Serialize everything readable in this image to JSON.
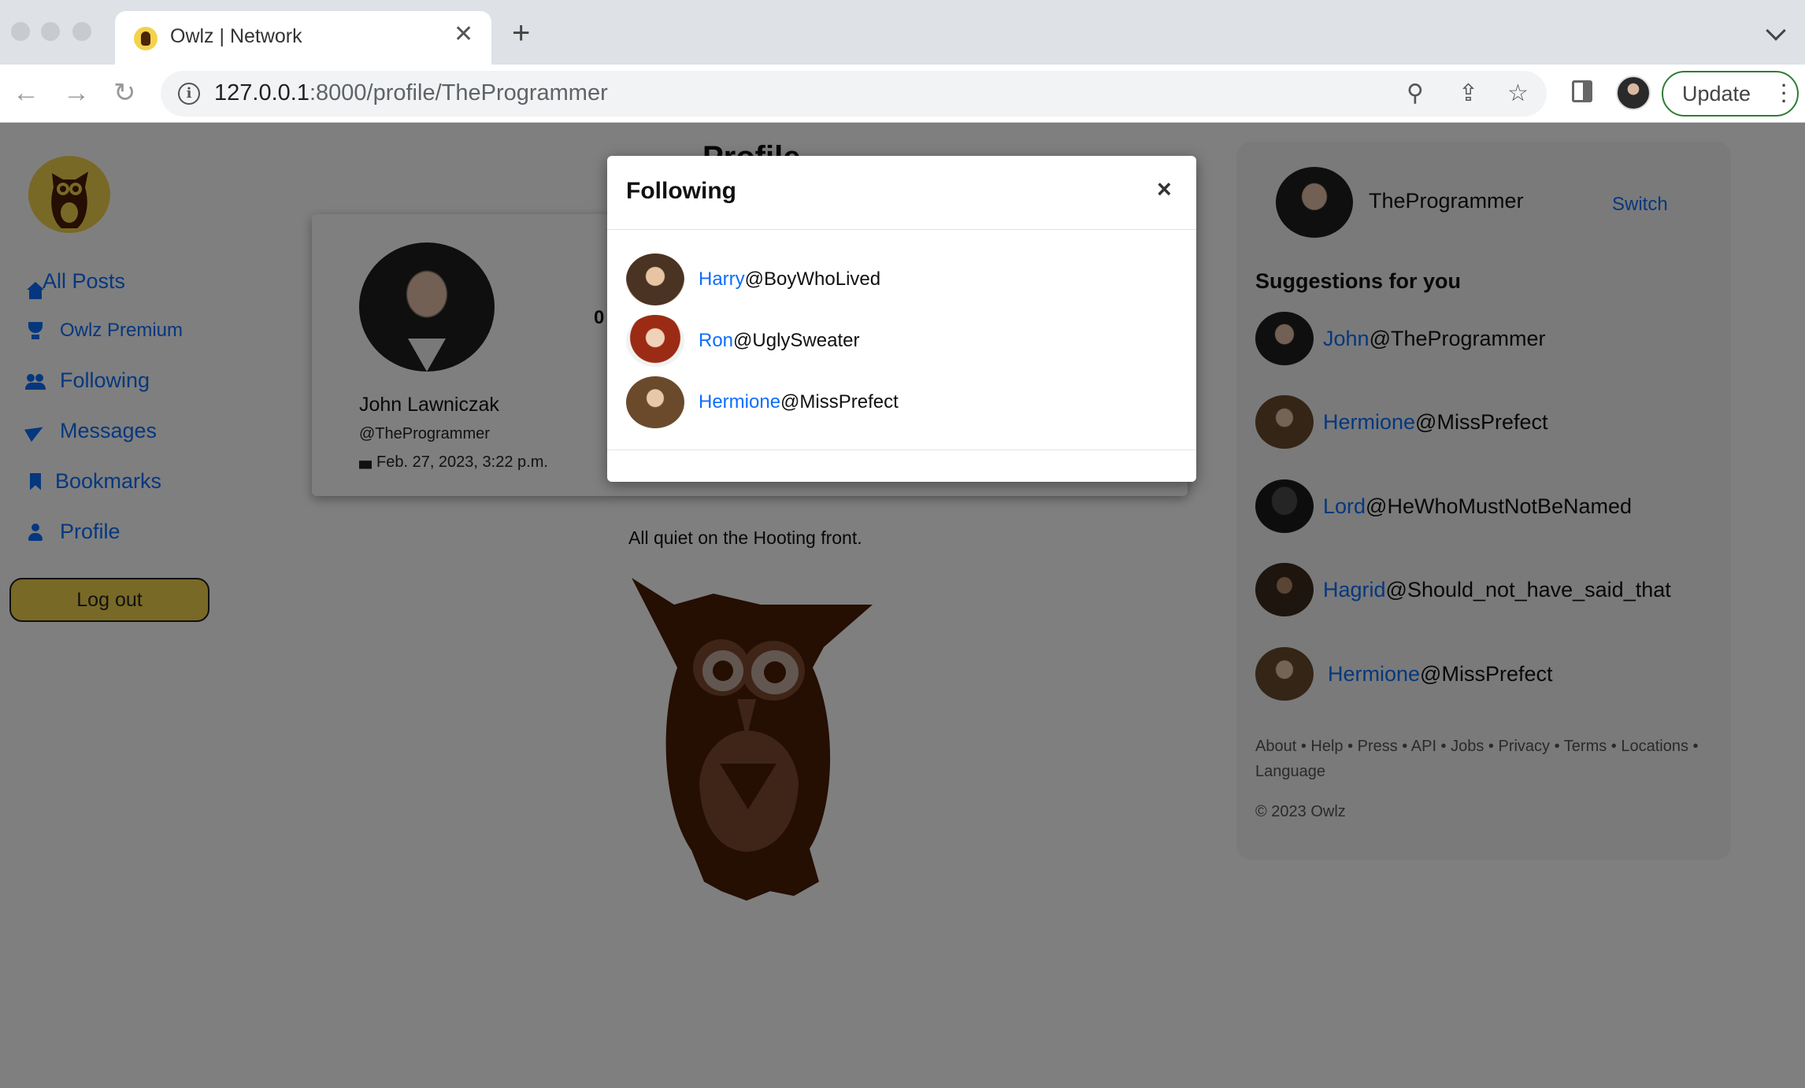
{
  "browser": {
    "tab_title": "Owlz | Network",
    "url_host": "127.0.0.1",
    "url_rest": ":8000/profile/TheProgrammer",
    "update_label": "Update"
  },
  "sidebar": {
    "items": [
      {
        "label": "All Posts",
        "icon": "home-icon"
      },
      {
        "label": "Owlz Premium",
        "icon": "trophy-icon"
      },
      {
        "label": "Following",
        "icon": "people-icon"
      },
      {
        "label": "Messages",
        "icon": "send-icon"
      },
      {
        "label": "Bookmarks",
        "icon": "bookmark-icon"
      },
      {
        "label": "Profile",
        "icon": "person-icon"
      }
    ],
    "logout_label": "Log out"
  },
  "main": {
    "page_title": "Profile",
    "profile": {
      "name": "John Lawniczak",
      "handle": "@TheProgrammer",
      "joined": "Feb. 27, 2023, 3:22 p.m.",
      "stat_visible": "0"
    },
    "empty_message": "All quiet on the Hooting front."
  },
  "right_panel": {
    "username": "TheProgrammer",
    "switch_label": "Switch",
    "heading": "Suggestions for you",
    "suggestions": [
      {
        "name": "John",
        "handle": "@TheProgrammer"
      },
      {
        "name": "Hermione",
        "handle": "@MissPrefect"
      },
      {
        "name": "Lord",
        "handle": "@HeWhoMustNotBeNamed"
      },
      {
        "name": "Hagrid",
        "handle": "@Should_not_have_said_that"
      },
      {
        "name": "Hermione",
        "handle": "@MissPrefect"
      }
    ],
    "footer_links": "About • Help • Press • API • Jobs • Privacy • Terms • Locations • Language",
    "copyright": "© 2023 Owlz"
  },
  "modal": {
    "title": "Following",
    "close_label": "×",
    "items": [
      {
        "name": "Harry",
        "handle": "@BoyWhoLived"
      },
      {
        "name": "Ron",
        "handle": "@UglySweater"
      },
      {
        "name": "Hermione",
        "handle": "@MissPrefect"
      }
    ]
  },
  "colors": {
    "accent": "#0d6efd",
    "brand_yellow": "#f3d24c",
    "owl_brown": "#4a1c04",
    "backdrop": "rgba(0,0,0,0.5)"
  }
}
